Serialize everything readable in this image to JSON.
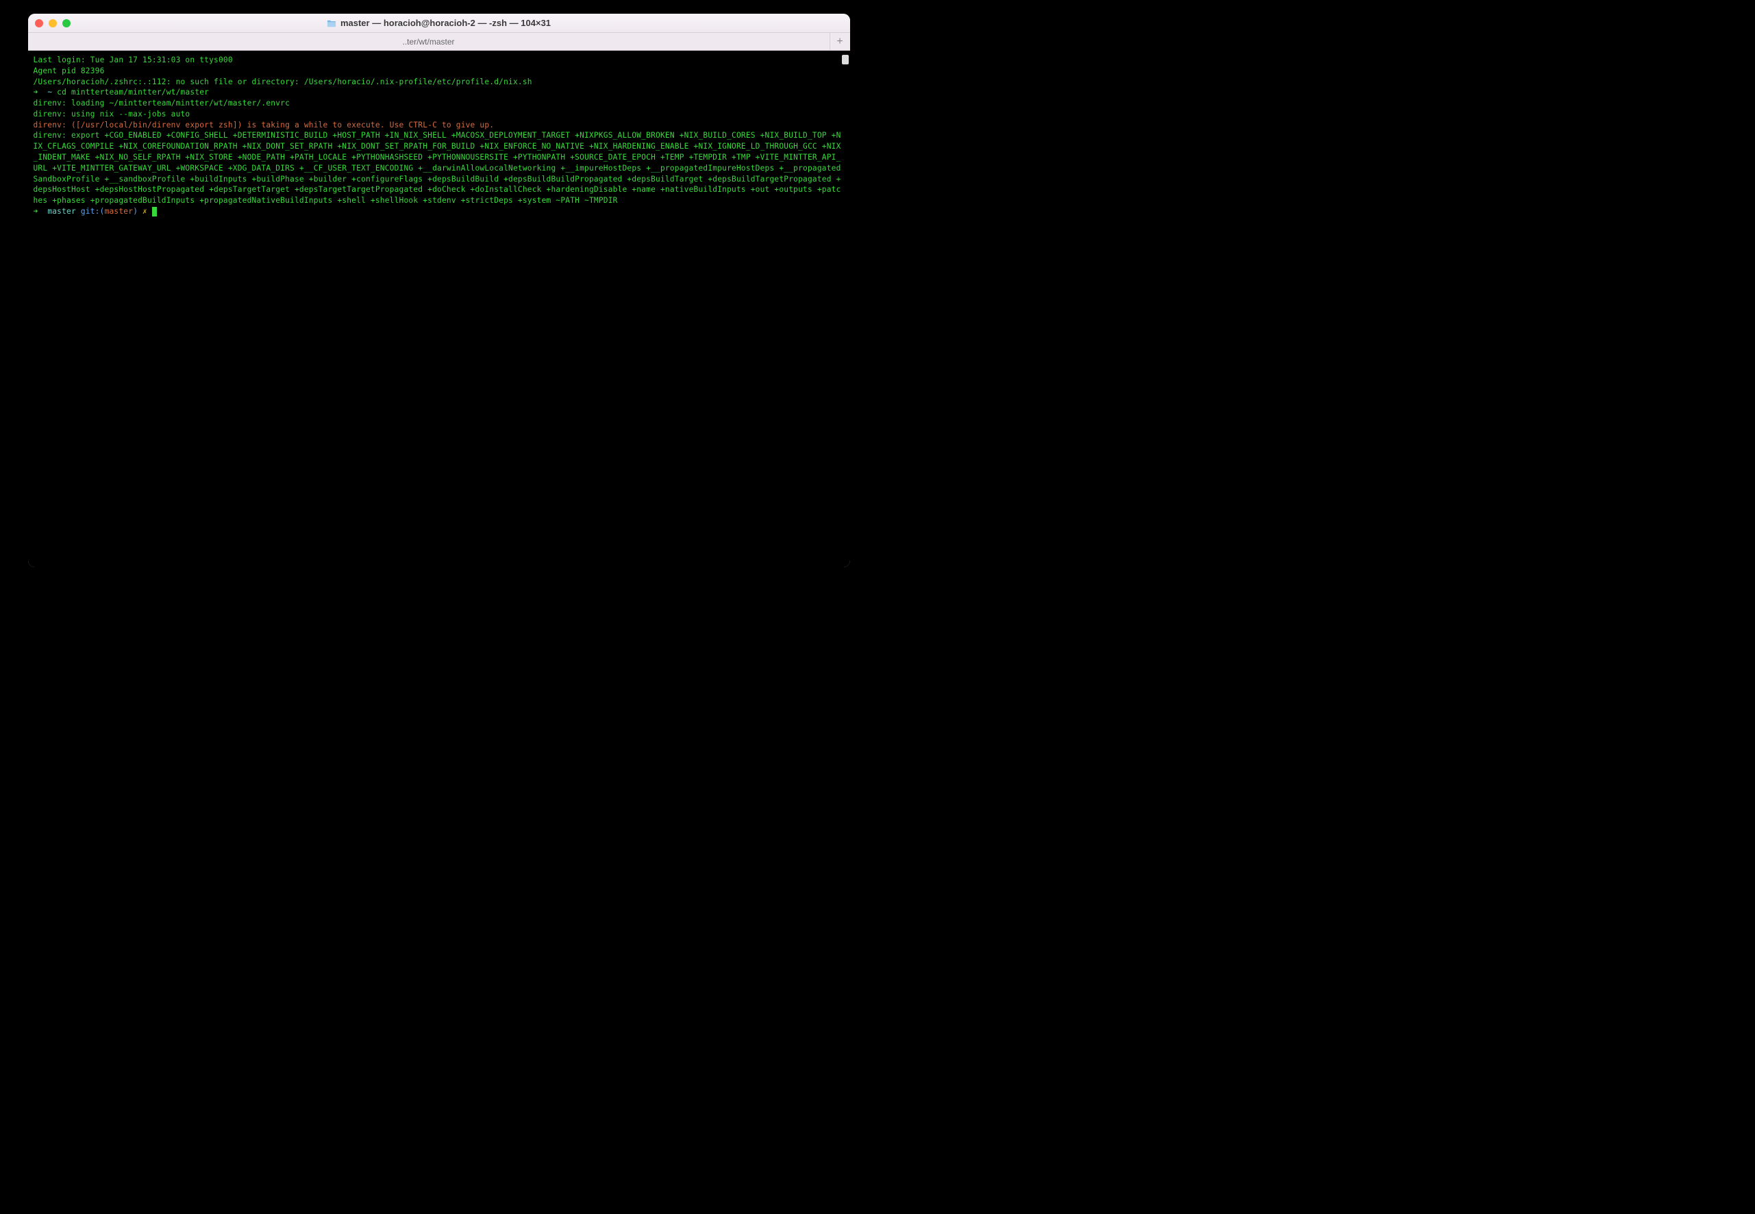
{
  "window": {
    "title": "master — horacioh@horacioh-2 — -zsh — 104×31"
  },
  "tab": {
    "label": "..ter/wt/master"
  },
  "term": {
    "last_login": "Last login: Tue Jan 17 15:31:03 on ttys000",
    "agent": "Agent pid 82396",
    "zshrc_err": "/Users/horacioh/.zshrc:.:112: no such file or directory: /Users/horacio/.nix-profile/etc/profile.d/nix.sh",
    "arrow1": "➜  ",
    "tilde": "~",
    "cd_cmd": " cd mintterteam/mintter/wt/master",
    "direnv_loading": "direnv: loading ~/mintterteam/mintter/wt/master/.envrc",
    "direnv_using": "direnv: using nix --max-jobs auto",
    "direnv_slow": "direnv: ([/usr/local/bin/direnv export zsh]) is taking a while to execute. Use CTRL-C to give up.",
    "direnv_export": "direnv: export +CGO_ENABLED +CONFIG_SHELL +DETERMINISTIC_BUILD +HOST_PATH +IN_NIX_SHELL +MACOSX_DEPLOYMENT_TARGET +NIXPKGS_ALLOW_BROKEN +NIX_BUILD_CORES +NIX_BUILD_TOP +NIX_CFLAGS_COMPILE +NIX_COREFOUNDATION_RPATH +NIX_DONT_SET_RPATH +NIX_DONT_SET_RPATH_FOR_BUILD +NIX_ENFORCE_NO_NATIVE +NIX_HARDENING_ENABLE +NIX_IGNORE_LD_THROUGH_GCC +NIX_INDENT_MAKE +NIX_NO_SELF_RPATH +NIX_STORE +NODE_PATH +PATH_LOCALE +PYTHONHASHSEED +PYTHONNOUSERSITE +PYTHONPATH +SOURCE_DATE_EPOCH +TEMP +TEMPDIR +TMP +VITE_MINTTER_API_URL +VITE_MINTTER_GATEWAY_URL +WORKSPACE +XDG_DATA_DIRS +__CF_USER_TEXT_ENCODING +__darwinAllowLocalNetworking +__impureHostDeps +__propagatedImpureHostDeps +__propagatedSandboxProfile +__sandboxProfile +buildInputs +buildPhase +builder +configureFlags +depsBuildBuild +depsBuildBuildPropagated +depsBuildTarget +depsBuildTargetPropagated +depsHostHost +depsHostHostPropagated +depsTargetTarget +depsTargetTargetPropagated +doCheck +doInstallCheck +hardeningDisable +name +nativeBuildInputs +out +outputs +patches +phases +propagatedBuildInputs +propagatedNativeBuildInputs +shell +shellHook +stdenv +strictDeps +system ~PATH ~TMPDIR",
    "arrow2": "➜  ",
    "dir": "master",
    "git_lbl": " git:(",
    "branch": "master",
    "git_close": ")",
    "dirty": " ✗ "
  }
}
